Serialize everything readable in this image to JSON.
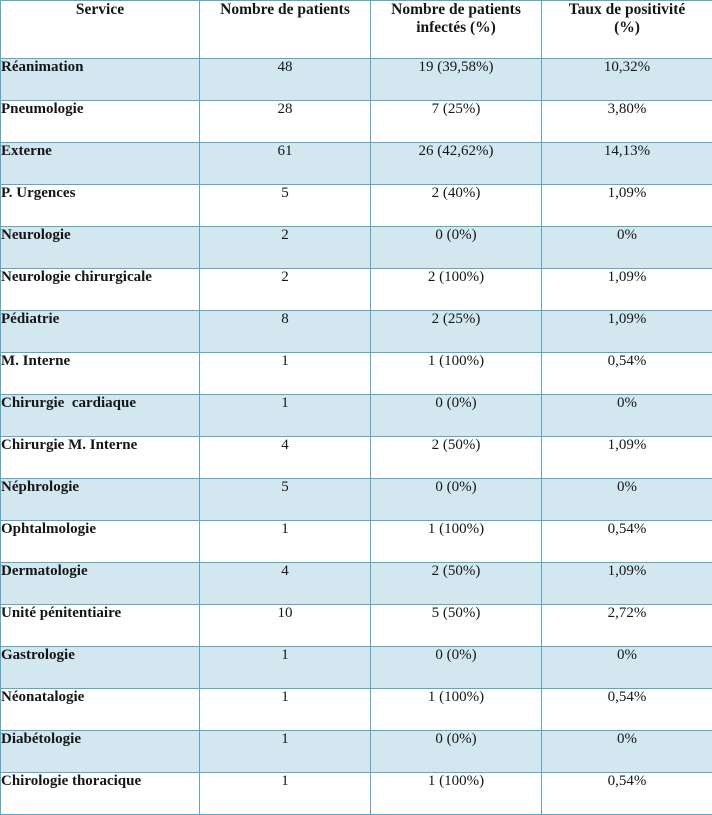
{
  "table": {
    "columns": [
      {
        "key": "service",
        "label": "Service"
      },
      {
        "key": "patients",
        "label": "Nombre de patients"
      },
      {
        "key": "infected",
        "label": "Nombre de patients infectés (%)"
      },
      {
        "key": "positivity",
        "label": "Taux de positivité (%)"
      }
    ],
    "column_label_lines": {
      "service": [
        "Service"
      ],
      "patients": [
        "Nombre de patients"
      ],
      "infected": [
        "Nombre de patients",
        "infectés (%)"
      ],
      "positivity": [
        "Taux de positivité",
        "(%)"
      ]
    },
    "rows": [
      {
        "service": "Réanimation",
        "patients": "48",
        "infected": "19 (39,58%)",
        "positivity": "10,32%",
        "shaded": true
      },
      {
        "service": "Pneumologie",
        "patients": "28",
        "infected": "7 (25%)",
        "positivity": "3,80%",
        "shaded": false
      },
      {
        "service": "Externe",
        "patients": "61",
        "infected": "26 (42,62%)",
        "positivity": "14,13%",
        "shaded": true
      },
      {
        "service": "P. Urgences",
        "patients": "5",
        "infected": "2 (40%)",
        "positivity": "1,09%",
        "shaded": false
      },
      {
        "service": "Neurologie",
        "patients": "2",
        "infected": "0 (0%)",
        "positivity": "0%",
        "shaded": true
      },
      {
        "service": "Neurologie chirurgicale",
        "patients": "2",
        "infected": "2 (100%)",
        "positivity": "1,09%",
        "shaded": false
      },
      {
        "service": "Pédiatrie",
        "patients": "8",
        "infected": "2 (25%)",
        "positivity": "1,09%",
        "shaded": true
      },
      {
        "service": "M. Interne",
        "patients": "1",
        "infected": "1 (100%)",
        "positivity": "0,54%",
        "shaded": false
      },
      {
        "service": "Chirurgie  cardiaque",
        "patients": "1",
        "infected": "0 (0%)",
        "positivity": "0%",
        "shaded": true
      },
      {
        "service": "Chirurgie M. Interne",
        "patients": "4",
        "infected": "2 (50%)",
        "positivity": "1,09%",
        "shaded": false
      },
      {
        "service": "Néphrologie",
        "patients": "5",
        "infected": "0 (0%)",
        "positivity": "0%",
        "shaded": true
      },
      {
        "service": "Ophtalmologie",
        "patients": "1",
        "infected": "1 (100%)",
        "positivity": "0,54%",
        "shaded": false
      },
      {
        "service": "Dermatologie",
        "patients": "4",
        "infected": "2 (50%)",
        "positivity": "1,09%",
        "shaded": true
      },
      {
        "service": "Unité pénitentiaire",
        "patients": "10",
        "infected": "5 (50%)",
        "positivity": "2,72%",
        "shaded": false
      },
      {
        "service": "Gastrologie",
        "patients": "1",
        "infected": "0 (0%)",
        "positivity": "0%",
        "shaded": true
      },
      {
        "service": "Néonatalogie",
        "patients": "1",
        "infected": "1 (100%)",
        "positivity": "0,54%",
        "shaded": false
      },
      {
        "service": "Diabétologie",
        "patients": "1",
        "infected": "0 (0%)",
        "positivity": "0%",
        "shaded": true
      },
      {
        "service": "Chirologie thoracique",
        "patients": "1",
        "infected": "1 (100%)",
        "positivity": "0,54%",
        "shaded": false
      }
    ]
  },
  "colors": {
    "border": "#5aa9c4",
    "row_shaded": "#d2e7f0",
    "row_plain": "#ffffff",
    "text": "#161616"
  }
}
